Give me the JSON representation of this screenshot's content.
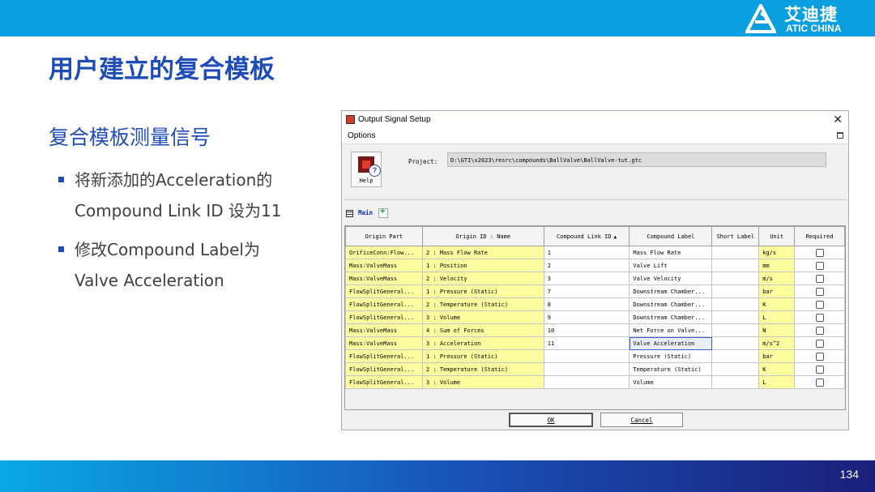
{
  "header": {
    "logo_cn": "艾迪捷",
    "logo_en": "ATIC CHINA",
    "accent_color": "#0aa0df"
  },
  "slide": {
    "title": "用户建立的复合模板",
    "section_heading": "复合模板测量信号",
    "bullets": [
      {
        "line1": "将新添加的Acceleration的",
        "line2": "Compound Link ID 设为11"
      },
      {
        "line1": "修改Compound Label为",
        "line2": "Valve  Acceleration"
      }
    ],
    "page_number": "134"
  },
  "dialog": {
    "title": "Output Signal Setup",
    "menu": {
      "options": "Options"
    },
    "help_label": "Help",
    "project_label": "Project:",
    "project_path": "D:\\GTI\\v2023\\resrc\\compounds\\BallValve\\BallValve-tut.gtc",
    "tab_label": "Main",
    "columns": [
      "Origin Part",
      "Origin ID : Name",
      "Compound Link ID",
      "Compound Label",
      "Short Label",
      "Unit",
      "Required"
    ],
    "rows": [
      {
        "part": "OrificeConn:Flow...",
        "id": "2 : Mass Flow Rate",
        "link": "1",
        "label": "Mass Flow Rate",
        "short": "",
        "unit": "kg/s"
      },
      {
        "part": "Mass:ValveMass",
        "id": "1 : Position",
        "link": "2",
        "label": "Valve Lift",
        "short": "",
        "unit": "mm"
      },
      {
        "part": "Mass:ValveMass",
        "id": "2 : Velocity",
        "link": "3",
        "label": "Valve Velocity",
        "short": "",
        "unit": "m/s"
      },
      {
        "part": "FlowSplitGeneral...",
        "id": "1 : Pressure (Static)",
        "link": "7",
        "label": "Downstream Chamber...",
        "short": "",
        "unit": "bar"
      },
      {
        "part": "FlowSplitGeneral...",
        "id": "2 : Temperature (Static)",
        "link": "8",
        "label": "Downstream Chamber...",
        "short": "",
        "unit": "K"
      },
      {
        "part": "FlowSplitGeneral...",
        "id": "3 : Volume",
        "link": "9",
        "label": "Downstream Chamber...",
        "short": "",
        "unit": "L"
      },
      {
        "part": "Mass:ValveMass",
        "id": "4 : Sum of Forces",
        "link": "10",
        "label": "Net Force on Valve...",
        "short": "",
        "unit": "N"
      },
      {
        "part": "Mass:ValveMass",
        "id": "3 : Acceleration",
        "link": "11",
        "label": "Valve Acceleration",
        "short": "",
        "unit": "m/s^2"
      },
      {
        "part": "FlowSplitGeneral...",
        "id": "1 : Pressure (Static)",
        "link": "",
        "label": "Pressure (Static)",
        "short": "",
        "unit": "bar"
      },
      {
        "part": "FlowSplitGeneral...",
        "id": "2 : Temperature (Static)",
        "link": "",
        "label": "Temperature (Static)",
        "short": "",
        "unit": "K"
      },
      {
        "part": "FlowSplitGeneral...",
        "id": "3 : Volume",
        "link": "",
        "label": "Volume",
        "short": "",
        "unit": "L"
      }
    ],
    "ok_label": "OK",
    "cancel_label": "Cancel"
  }
}
